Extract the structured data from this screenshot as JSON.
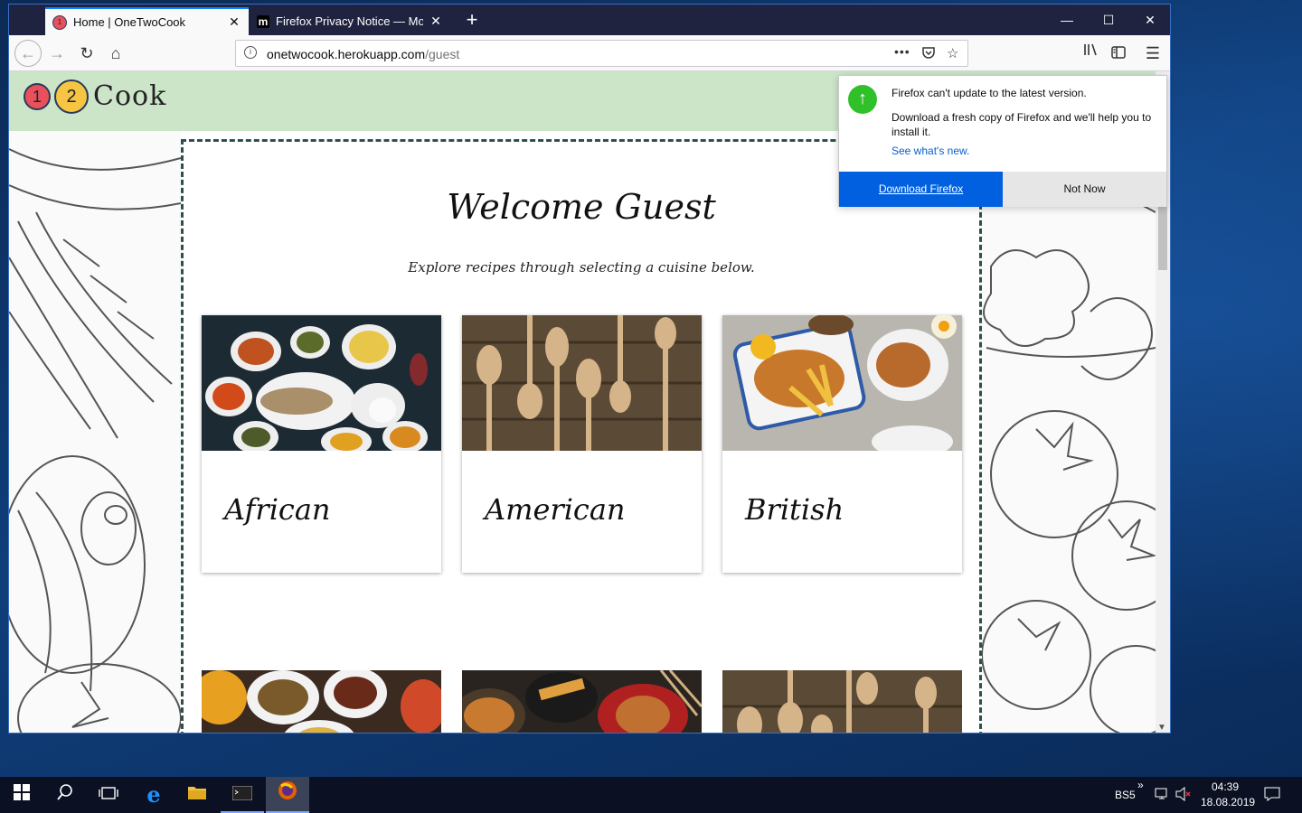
{
  "browser": {
    "tabs": [
      {
        "title": "Home | OneTwoCook",
        "active": true,
        "favicon": "onetwocook-favicon"
      },
      {
        "title": "Firefox Privacy Notice — Mozill",
        "active": false,
        "favicon": "mozilla-m-icon"
      }
    ],
    "url_host": "onetwocook.herokuapp.com",
    "url_path": "/guest",
    "url_actions": "•••"
  },
  "site": {
    "logo_one": "1",
    "logo_two": "2",
    "logo_word": "Cook",
    "welcome": "Welcome Guest",
    "subtitle": "Explore recipes through selecting a cuisine below.",
    "cuisines": [
      {
        "label": "African"
      },
      {
        "label": "American"
      },
      {
        "label": "British"
      }
    ]
  },
  "update_popup": {
    "line1": "Firefox can't update to the latest version.",
    "line2": "Download a fresh copy of Firefox and we'll help you to install it.",
    "link": "See what's new.",
    "primary": "Download Firefox",
    "secondary": "Not Now"
  },
  "taskbar": {
    "keyboard": "BS5",
    "time": "04:39",
    "date": "18.08.2019"
  },
  "colors": {
    "header_green": "#cce5c8",
    "logo_red": "#e8505b",
    "logo_yellow": "#f5c543",
    "primary_blue": "#0060df",
    "update_green": "#30c02a"
  }
}
